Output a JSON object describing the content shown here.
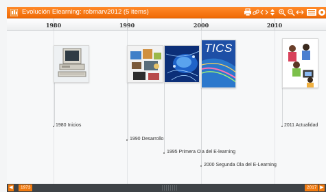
{
  "window": {
    "title": "Evolución Elearning: robmarv2012  (5 items)"
  },
  "toolbar": {
    "icons": [
      "print-icon",
      "link-icon",
      "embed-icon",
      "updown-icon",
      "zoom-in-icon",
      "zoom-out-icon",
      "fit-icon",
      "list-view-icon",
      "settings-icon"
    ]
  },
  "years": [
    "1980",
    "1990",
    "2000",
    "2010"
  ],
  "events": [
    {
      "label": "1980 Inicios",
      "image": "computer-image"
    },
    {
      "label": "1990 Desarrollo",
      "image": "collage-image"
    },
    {
      "label": "1995 Primera Ola del E-learning",
      "image": "network-image"
    },
    {
      "label": "2000 Segunda Ola del E-Learning",
      "image": "tics-image",
      "image_text": "TICS"
    },
    {
      "label": "2011 Actualidad",
      "image": "students-image"
    }
  ],
  "nav": {
    "start_year": "1973",
    "end_year": "2017"
  },
  "colors": {
    "accent": "#f07a10",
    "nav_bg": "#3e4347"
  }
}
